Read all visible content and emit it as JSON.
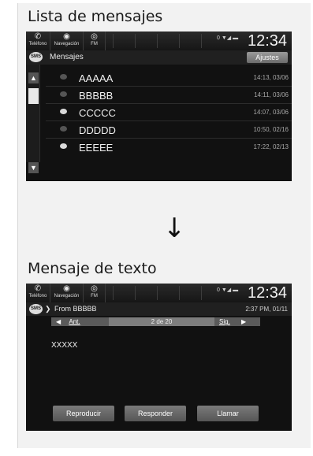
{
  "section1": {
    "title": "Lista de mensajes",
    "statusbar": {
      "phone_label": "Teléfono",
      "nav_label": "Navegación",
      "fm_label": "FM",
      "signal": "0 ▼◢ ▬",
      "clock": "12:34"
    },
    "header": {
      "sms_badge": "SMS",
      "title": "Mensajes",
      "settings_label": "Ajustes"
    },
    "scroll": {
      "up_icon": "▲",
      "down_icon": "▼"
    },
    "messages": [
      {
        "name": "AAAAA",
        "time": "14:13, 03/06",
        "unread": false
      },
      {
        "name": "BBBBB",
        "time": "14:11, 03/06",
        "unread": false
      },
      {
        "name": "CCCCC",
        "time": "14:07, 03/06",
        "unread": true
      },
      {
        "name": "DDDDD",
        "time": "10:50, 02/16",
        "unread": false
      },
      {
        "name": "EEEEE",
        "time": "17:22, 02/13",
        "unread": true
      }
    ]
  },
  "arrow": "↓",
  "section2": {
    "title": "Mensaje de texto",
    "statusbar": {
      "phone_label": "Teléfono",
      "nav_label": "Navegación",
      "fm_label": "FM",
      "signal": "0 ▼◢ ▬",
      "clock": "12:34"
    },
    "header": {
      "sms_badge": "SMS",
      "title": "From BBBBB",
      "time": "2:37 PM, 01/11"
    },
    "nav": {
      "prev_label": "Ant.",
      "count": "2 de 20",
      "next_label": "Sig."
    },
    "body": "XXXXX",
    "buttons": {
      "play": "Reproducir",
      "reply": "Responder",
      "call": "Llamar"
    }
  },
  "colors": {
    "screen_bg": "#111111",
    "unread_icon": "#d9d9d9",
    "read_icon": "#555555"
  }
}
